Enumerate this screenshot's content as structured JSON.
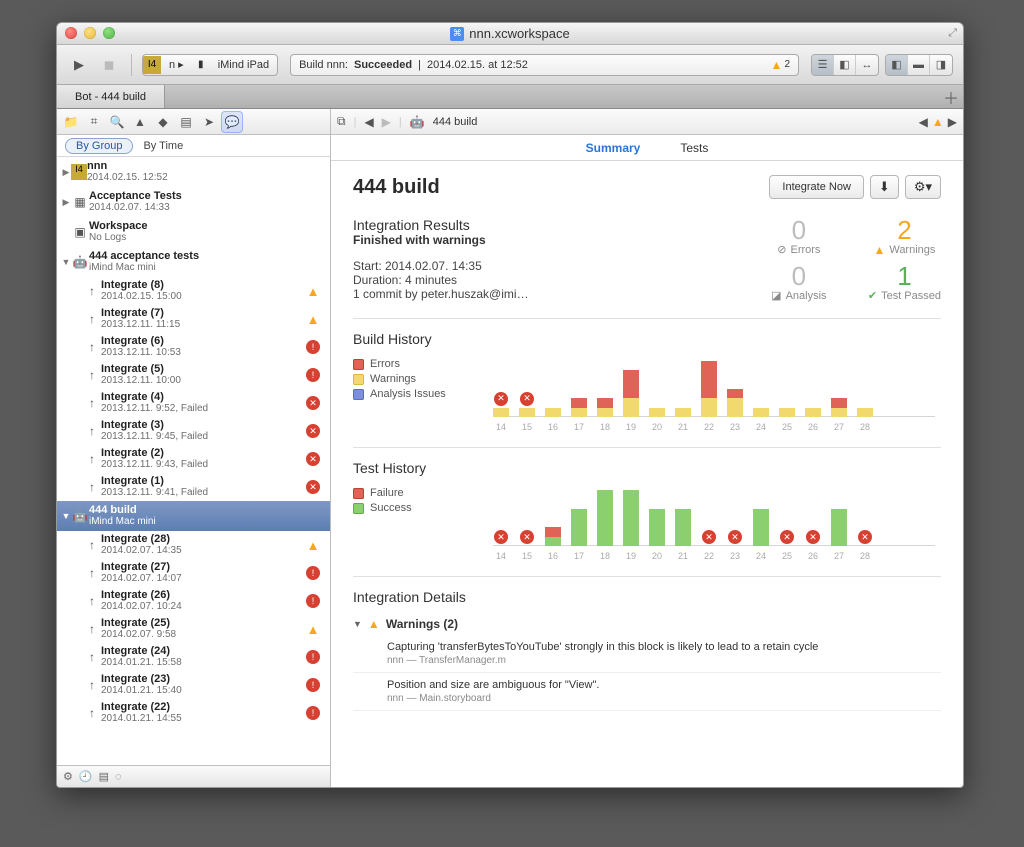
{
  "window": {
    "title": "nnn.xcworkspace"
  },
  "toolbar": {
    "scheme_left": "n ▸",
    "scheme_right": "iMind iPad",
    "activity_prefix": "Build nnn: ",
    "activity_status": "Succeeded",
    "activity_sep": "  |  ",
    "activity_time": "2014.02.15. at 12:52",
    "activity_warn_count": "2"
  },
  "tab": {
    "title": "Bot - 444 build"
  },
  "nav_filters": {
    "by_group": "By Group",
    "by_time": "By Time"
  },
  "tree": {
    "nnn": {
      "name": "nnn",
      "sub": "2014.02.15. 12:52"
    },
    "acceptance": {
      "name": "Acceptance Tests",
      "sub": "2014.02.07. 14:33"
    },
    "workspace": {
      "name": "Workspace",
      "sub": "No Logs"
    },
    "acc444": {
      "name": "444 acceptance tests",
      "sub": "iMind Mac mini"
    },
    "build444": {
      "name": "444 build",
      "sub": "iMind Mac mini"
    },
    "a8": {
      "name": "Integrate (8)",
      "sub": "2014.02.15. 15:00"
    },
    "a7": {
      "name": "Integrate (7)",
      "sub": "2013.12.11. 11:15"
    },
    "a6": {
      "name": "Integrate (6)",
      "sub": "2013.12.11. 10:53"
    },
    "a5": {
      "name": "Integrate (5)",
      "sub": "2013.12.11. 10:00"
    },
    "a4": {
      "name": "Integrate (4)",
      "sub": "2013.12.11. 9:52, Failed"
    },
    "a3": {
      "name": "Integrate (3)",
      "sub": "2013.12.11. 9:45, Failed"
    },
    "a2": {
      "name": "Integrate (2)",
      "sub": "2013.12.11. 9:43, Failed"
    },
    "a1": {
      "name": "Integrate (1)",
      "sub": "2013.12.11. 9:41, Failed"
    },
    "b28": {
      "name": "Integrate (28)",
      "sub": "2014.02.07. 14:35"
    },
    "b27": {
      "name": "Integrate (27)",
      "sub": "2014.02.07. 14:07"
    },
    "b26": {
      "name": "Integrate (26)",
      "sub": "2014.02.07. 10:24"
    },
    "b25": {
      "name": "Integrate (25)",
      "sub": "2014.02.07. 9:58"
    },
    "b24": {
      "name": "Integrate (24)",
      "sub": "2014.01.21. 15:58"
    },
    "b23": {
      "name": "Integrate (23)",
      "sub": "2014.01.21. 15:40"
    },
    "b22": {
      "name": "Integrate (22)",
      "sub": "2014.01.21. 14:55"
    }
  },
  "jumpbar": {
    "crumb": "444 build"
  },
  "subtabs": {
    "summary": "Summary",
    "tests": "Tests"
  },
  "page": {
    "title": "444 build",
    "integrate_now": "Integrate Now",
    "results_title": "Integration Results",
    "results_state": "Finished with warnings",
    "start": "Start: 2014.02.07. 14:35",
    "duration": "Duration: 4 minutes",
    "commits": "1 commit by peter.huszak@imi…",
    "errors_n": "0",
    "errors_l": "Errors",
    "warnings_n": "2",
    "warnings_l": "Warnings",
    "analysis_n": "0",
    "analysis_l": "Analysis",
    "passed_n": "1",
    "passed_l": "Test Passed",
    "build_history": "Build History",
    "test_history": "Test History",
    "legend_errors": "Errors",
    "legend_warnings": "Warnings",
    "legend_analysis": "Analysis Issues",
    "legend_failure": "Failure",
    "legend_success": "Success",
    "details_title": "Integration Details",
    "details_warnings": "Warnings (2)",
    "w1_msg": "Capturing 'transferBytesToYouTube' strongly in this block is likely to lead to a retain cycle",
    "w1_sub": "nnn — TransferManager.m",
    "w2_msg": "Position and size are ambiguous for \"View\".",
    "w2_sub": "nnn — Main.storyboard"
  },
  "chart_data": [
    {
      "type": "bar",
      "title": "Build History",
      "categories": [
        "14",
        "15",
        "16",
        "17",
        "18",
        "19",
        "20",
        "21",
        "22",
        "23",
        "24",
        "25",
        "26",
        "27",
        "28"
      ],
      "series": [
        {
          "name": "Errors",
          "values": [
            0,
            0,
            0,
            1,
            1,
            3,
            0,
            0,
            4,
            1,
            0,
            0,
            0,
            1,
            0
          ]
        },
        {
          "name": "Warnings",
          "values": [
            1,
            1,
            1,
            1,
            1,
            2,
            1,
            1,
            2,
            2,
            1,
            1,
            1,
            1,
            1
          ]
        }
      ],
      "failed": {
        "14": true,
        "15": true
      },
      "ylim": [
        0,
        6
      ]
    },
    {
      "type": "bar",
      "title": "Test History",
      "categories": [
        "14",
        "15",
        "16",
        "17",
        "18",
        "19",
        "20",
        "21",
        "22",
        "23",
        "24",
        "25",
        "26",
        "27",
        "28"
      ],
      "series": [
        {
          "name": "Failure",
          "values": [
            0,
            0,
            1,
            0,
            0,
            0,
            0,
            0,
            0,
            0,
            0,
            0,
            0,
            0,
            0
          ]
        },
        {
          "name": "Success",
          "values": [
            0,
            0,
            1,
            4,
            6,
            6,
            4,
            4,
            0,
            0,
            4,
            0,
            0,
            4,
            0
          ]
        }
      ],
      "failed": {
        "14": true,
        "15": true,
        "22": true,
        "23": true,
        "25": true,
        "26": true,
        "28": true
      },
      "ylim": [
        0,
        6
      ]
    }
  ]
}
